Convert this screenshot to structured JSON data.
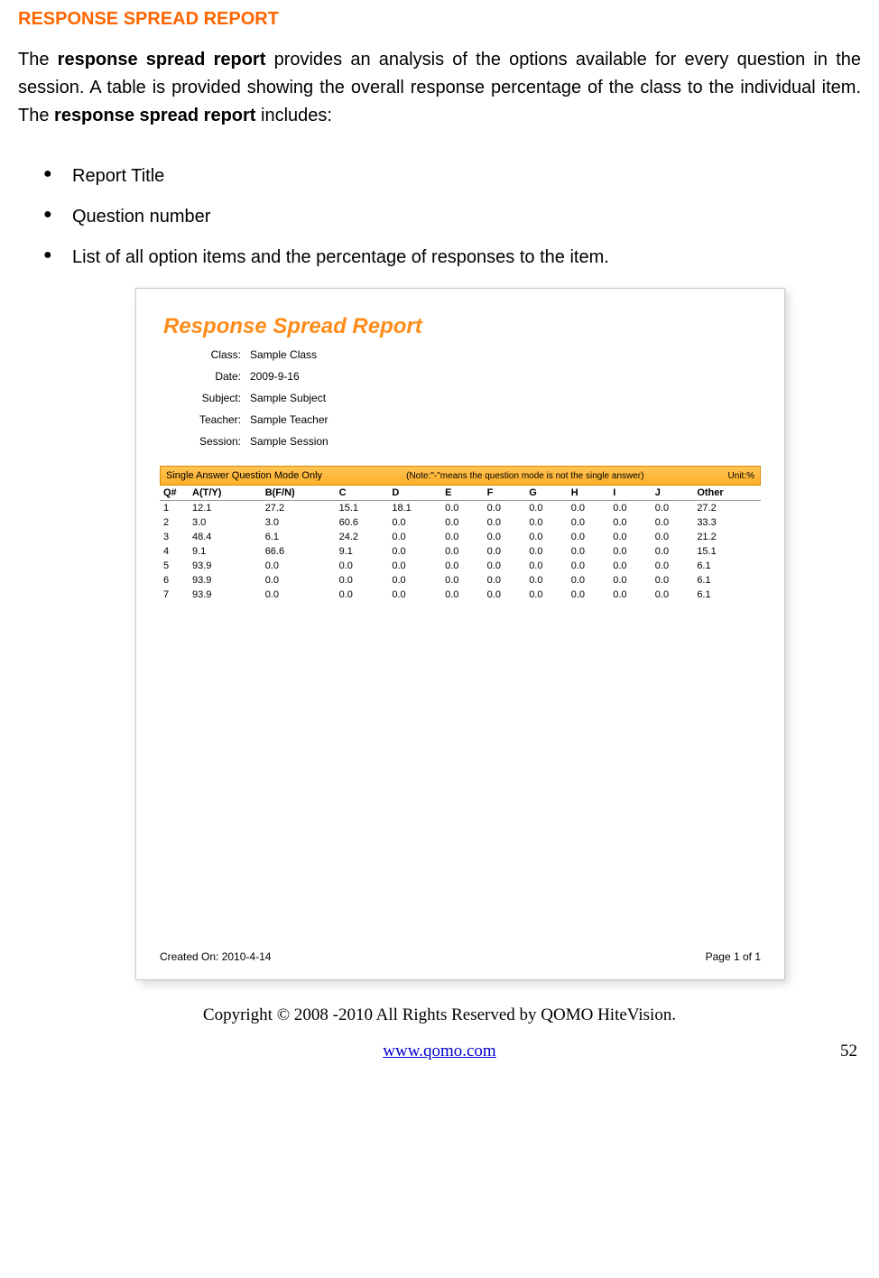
{
  "section_title": "RESPONSE SPREAD REPORT",
  "intro": {
    "pre": "The ",
    "bold1": "response spread report",
    "mid": " provides an analysis of the options available for every question in the session. A table is provided showing the overall response percentage of the class to the individual item. The ",
    "bold2": "response spread report",
    "post": " includes:"
  },
  "bullets": [
    "Report Title",
    "Question number",
    "List of all option items and the percentage of responses to the item."
  ],
  "report": {
    "title": "Response Spread Report",
    "meta": [
      {
        "label": "Class:",
        "value": "Sample Class"
      },
      {
        "label": "Date:",
        "value": "2009-9-16"
      },
      {
        "label": "Subject:",
        "value": "Sample Subject"
      },
      {
        "label": "Teacher:",
        "value": "Sample Teacher"
      },
      {
        "label": "Session:",
        "value": "Sample Session"
      }
    ],
    "note_left": "Single Answer Question Mode Only",
    "note_mid": "(Note:\"-\"means the question mode is not the single answer)",
    "note_right": "Unit:%",
    "columns": [
      "Q#",
      "A(T/Y)",
      "B(F/N)",
      "C",
      "D",
      "E",
      "F",
      "G",
      "H",
      "I",
      "J",
      "Other"
    ],
    "rows": [
      [
        "1",
        "12.1",
        "27.2",
        "15.1",
        "18.1",
        "0.0",
        "0.0",
        "0.0",
        "0.0",
        "0.0",
        "0.0",
        "27.2"
      ],
      [
        "2",
        "3.0",
        "3.0",
        "60.6",
        "0.0",
        "0.0",
        "0.0",
        "0.0",
        "0.0",
        "0.0",
        "0.0",
        "33.3"
      ],
      [
        "3",
        "48.4",
        "6.1",
        "24.2",
        "0.0",
        "0.0",
        "0.0",
        "0.0",
        "0.0",
        "0.0",
        "0.0",
        "21.2"
      ],
      [
        "4",
        "9.1",
        "66.6",
        "9.1",
        "0.0",
        "0.0",
        "0.0",
        "0.0",
        "0.0",
        "0.0",
        "0.0",
        "15.1"
      ],
      [
        "5",
        "93.9",
        "0.0",
        "0.0",
        "0.0",
        "0.0",
        "0.0",
        "0.0",
        "0.0",
        "0.0",
        "0.0",
        "6.1"
      ],
      [
        "6",
        "93.9",
        "0.0",
        "0.0",
        "0.0",
        "0.0",
        "0.0",
        "0.0",
        "0.0",
        "0.0",
        "0.0",
        "6.1"
      ],
      [
        "7",
        "93.9",
        "0.0",
        "0.0",
        "0.0",
        "0.0",
        "0.0",
        "0.0",
        "0.0",
        "0.0",
        "0.0",
        "6.1"
      ]
    ],
    "created_on": "Created On: 2010-4-14",
    "page_info": "Page 1 of 1"
  },
  "copyright": "Copyright © 2008 -2010 All Rights Reserved by QOMO HiteVision.",
  "footer_url": "www.qomo.com",
  "page_number": "52"
}
